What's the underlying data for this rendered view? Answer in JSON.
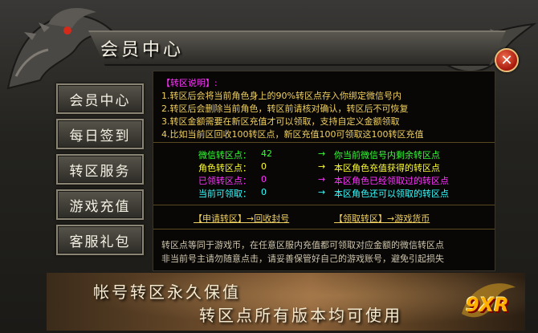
{
  "window": {
    "title": "会员中心"
  },
  "sidebar": {
    "items": [
      {
        "label": "会员中心"
      },
      {
        "label": "每日签到"
      },
      {
        "label": "转区服务"
      },
      {
        "label": "游戏充值"
      },
      {
        "label": "客服礼包"
      }
    ]
  },
  "info": {
    "title": "【转区说明】:",
    "rules": [
      "1.转区后会将当前角色身上的90%转区点存入你绑定微信号内",
      "2.转区后会删除当前角色，转区前请核对确认，转区后不可恢复",
      "3.转区金额需要在新区充值才可以领取，支持自定义金额领取",
      "4.比如当前区回收100转区点，新区充值100可领取这100转区充值"
    ]
  },
  "stats": [
    {
      "label": "微信转区点：",
      "value": "42",
      "arrow": "→",
      "desc": "你当前微信号内剩余转区点",
      "color": "#33ff33"
    },
    {
      "label": "角色转区点：",
      "value": "0",
      "arrow": "→",
      "desc": "本区角色充值获得的转区点",
      "color": "#ffff33"
    },
    {
      "label": "已领转区点：",
      "value": "0",
      "arrow": "→",
      "desc": "本区角色已经领取过的转区点",
      "color": "#ff33ff"
    },
    {
      "label": "当前可领取：",
      "value": "0",
      "arrow": "→",
      "desc": "本区角色还可以领取的转区点",
      "color": "#33ffff"
    }
  ],
  "actions": {
    "apply": "【申请转区】→回收封号",
    "receive": "【领取转区】→游戏货币"
  },
  "notes": [
    "转区点等同于游戏币，在任意区服内充值都可领取对应金额的微信转区点",
    "非当前号主请勿随意点击，请妥善保管好自己的游戏账号，避免引起损失"
  ],
  "banner": {
    "line1": "帐号转区永久保值",
    "line2": "转区点所有版本均可使用",
    "logo": "9XR"
  },
  "icons": {
    "close": "close-icon"
  }
}
